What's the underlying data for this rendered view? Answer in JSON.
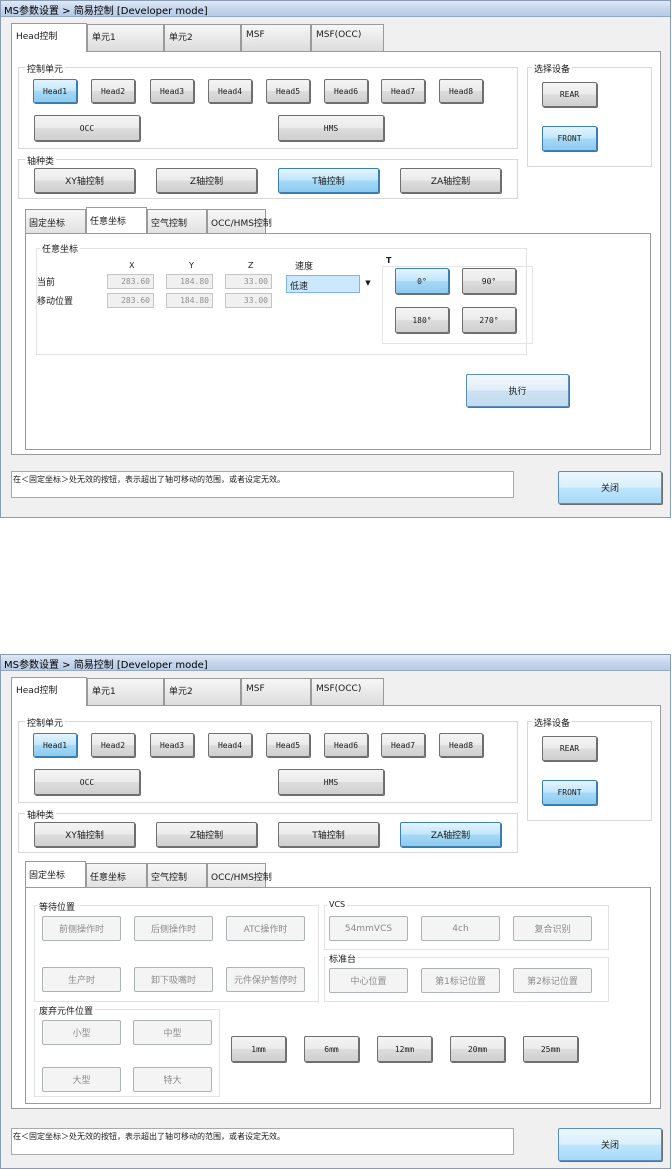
{
  "window_title": "MS参数设置 > 简易控制 [Developer mode]",
  "main_tabs": [
    "Head控制",
    "单元1",
    "单元2",
    "MSF",
    "MSF(OCC)"
  ],
  "control_unit": {
    "title": "控制单元",
    "heads": [
      "Head1",
      "Head2",
      "Head3",
      "Head4",
      "Head5",
      "Head6",
      "Head7",
      "Head8"
    ],
    "occ": "OCC",
    "hms": "HMS"
  },
  "select_device": {
    "title": "选择设备",
    "rear": "REAR",
    "front": "FRONT"
  },
  "axis_class": {
    "title": "轴种类",
    "xy": "XY轴控制",
    "z": "Z轴控制",
    "t": "T轴控制",
    "za": "ZA轴控制"
  },
  "sub_tabs": [
    "固定坐标",
    "任意坐标",
    "空气控制",
    "OCC/HMS控制"
  ],
  "arbitrary": {
    "group_title": "任意坐标",
    "col_x": "X",
    "col_y": "Y",
    "col_z": "Z",
    "speed_label": "速度",
    "t_label": "T",
    "row_current": "当前",
    "row_move": "移动位置",
    "current": {
      "x": "283.60",
      "y": "184.80",
      "z": "33.00"
    },
    "move": {
      "x": "283.60",
      "y": "184.80",
      "z": "33.00"
    },
    "speed_value": "低速",
    "speed_arrow": "▼",
    "t_buttons": [
      "0°",
      "90°",
      "180°",
      "270°"
    ],
    "execute": "执行"
  },
  "fixed": {
    "standby_title": "等待位置",
    "standby": [
      "前侧操作时",
      "后侧操作时",
      "ATC操作时",
      "生产时",
      "卸下吸嘴时",
      "元件保护暂停时"
    ],
    "vcs_title": "VCS",
    "vcs": [
      "54mmVCS",
      "4ch",
      "复合识别"
    ],
    "calib_title": "标准台",
    "calib": [
      "中心位置",
      "第1标记位置",
      "第2标记位置"
    ],
    "discard_title": "废弃元件位置",
    "discard": [
      "小型",
      "中型",
      "大型",
      "特大"
    ],
    "steps": [
      "1mm",
      "6mm",
      "12mm",
      "20mm",
      "25mm"
    ]
  },
  "status_text": "在＜固定坐标＞处无效的按钮，表示超出了轴可移动的范围，或者设定无效。",
  "close": "关闭",
  "colors": {
    "selected": "#8ccbef",
    "title_bar": "#c6d6ec"
  }
}
